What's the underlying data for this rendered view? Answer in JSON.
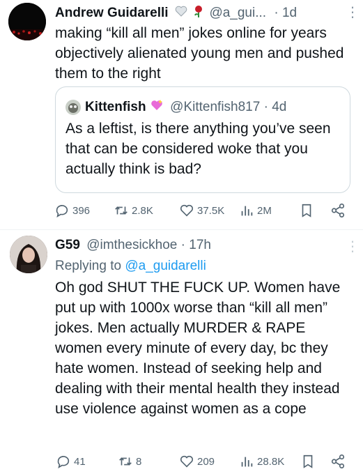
{
  "post1": {
    "author_name": "Andrew Guidarelli",
    "handle": "@a_gui...",
    "time": "· 1d",
    "more_label": "⋮",
    "text": "making “kill all men” jokes online for years objectively alienated young men and pushed them to the right",
    "quote": {
      "author_name": "Kittenfish",
      "handle": "@Kittenfish817",
      "time": "· 4d",
      "text": "As a leftist, is there anything you’ve seen that can be considered woke that you actually think is bad?"
    },
    "stats": {
      "replies": "396",
      "reposts": "2.8K",
      "likes": "37.5K",
      "views": "2M"
    }
  },
  "post2": {
    "author_name": "G59",
    "handle": "@imthesickhoe",
    "time": "· 17h",
    "more_label": "⋮",
    "replying_prefix": "Replying to",
    "replying_to": "@a_guidarelli",
    "text": "Oh god SHUT THE FUCK UP. Women have put up with 1000x worse than “kill all men” jokes. Men actually MURDER & RAPE women every minute of every day, bc they hate women. Instead of seeking help and dealing with their mental health they instead use violence against women as a cope",
    "stats": {
      "replies": "41",
      "reposts": "8",
      "likes": "209",
      "views": "28.8K"
    }
  },
  "colors": {
    "link": "#1d9bf0",
    "muted": "#536471",
    "border": "#cfd9de"
  }
}
